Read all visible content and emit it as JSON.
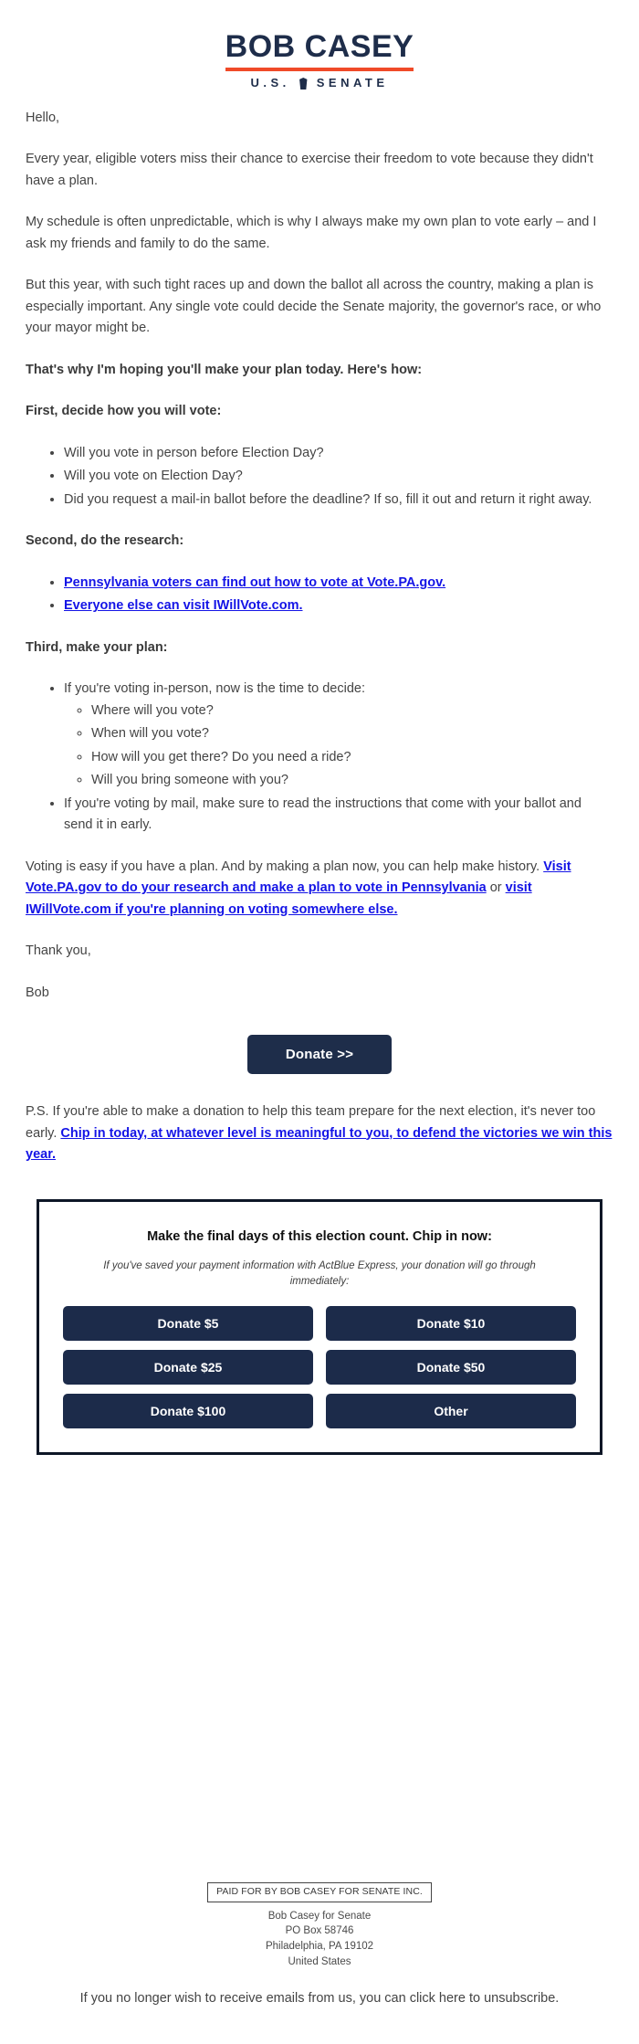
{
  "header": {
    "logo_name": "BOB CASEY",
    "logo_sub_left": "U.S.",
    "logo_sub_right": "SENATE",
    "accent_red": "#f04a28",
    "brand_navy": "#1e2d4a"
  },
  "body": {
    "greeting": "Hello,",
    "p1": "Every year, eligible voters miss their chance to exercise their freedom to vote because they didn't have a plan.",
    "p2": "My schedule is often unpredictable, which is why I always make my own plan to vote early – and I ask my friends and family to do the same.",
    "p3": "But this year, with such tight races up and down the ballot all across the country, making a plan is especially important. Any single vote could decide the Senate majority, the governor's race, or who your mayor might be.",
    "p4_bold": "That's why I'm hoping you'll make your plan today. Here's how:",
    "first_head": "First, decide how you will vote:",
    "first_bullets": [
      "Will you vote in person before Election Day?",
      "Will you vote on Election Day?",
      "Did you request a mail-in ballot before the deadline? If so, fill it out and return it right away."
    ],
    "second_head": "Second, do the research:",
    "second_links": [
      "Pennsylvania voters can find out how to vote at Vote.PA.gov.",
      "Everyone else can visit IWillVote.com."
    ],
    "third_head": "Third, make your plan:",
    "third_bullet_1": "If you're voting in-person, now is the time to decide:",
    "third_sub_bullets": [
      "Where will you vote?",
      "When will you vote?",
      "How will you get there? Do you need a ride?",
      "Will you bring someone with you?"
    ],
    "third_bullet_2": "If you're voting by mail, make sure to read the instructions that come with your ballot and send it in early.",
    "closing_pre": "Voting is easy if you have a plan. And by making a plan now, you can help make history. ",
    "closing_link_1": "Visit Vote.PA.gov to do your research and make a plan to vote in Pennsylvania",
    "closing_mid": " or ",
    "closing_link_2": "visit IWillVote.com if you're planning on voting somewhere else.",
    "thanks": "Thank you,",
    "signature": "Bob",
    "ps_pre": "P.S. If you're able to make a donation to help this team prepare for the next election, it's never too early. ",
    "ps_link": "Chip in today, at whatever level is meaningful to you, to defend the victories we win this year."
  },
  "cta": {
    "donate_label": "Donate >>"
  },
  "donate_box": {
    "title": "Make the final days of this election count. Chip in now:",
    "subtitle": "If you've saved your payment information with ActBlue Express, your donation will go through immediately:",
    "buttons": [
      "Donate $5",
      "Donate $10",
      "Donate $25",
      "Donate $50",
      "Donate $100",
      "Other"
    ]
  },
  "footer": {
    "paid_for": "PAID FOR BY BOB CASEY FOR SENATE INC.",
    "org": "Bob Casey for Senate",
    "po_box": "PO Box 58746",
    "city_state_zip": "Philadelphia, PA 19102",
    "country": "United States",
    "unsub_pre": "If you no longer wish to receive emails from us, you can click here to ",
    "unsub_link": "unsubscribe."
  }
}
